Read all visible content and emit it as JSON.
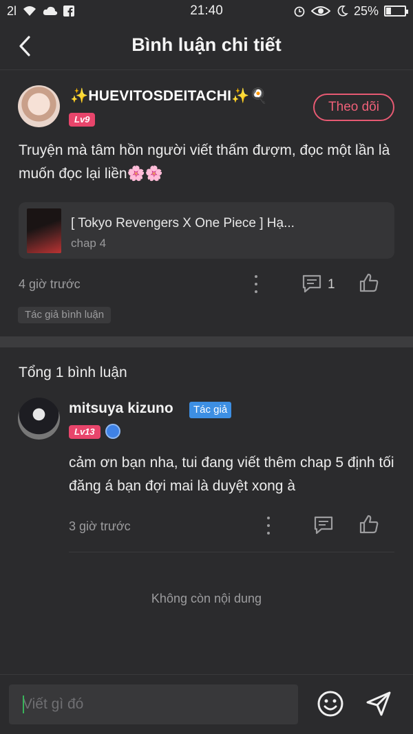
{
  "status_bar": {
    "signal": "2l",
    "time": "21:40",
    "battery": "25%",
    "battery_level": 0.25
  },
  "header": {
    "title": "Bình luận chi tiết"
  },
  "post": {
    "username": "✨HUEVITOSDEITACHI✨🍳",
    "level": "Lv9",
    "follow_label": "Theo dõi",
    "text": "Truyện mà tâm hồn người viết thấm đượm, đọc một lần là muốn đọc lại liền🌸🌸",
    "book": {
      "title": "[ Tokyo Revengers X One Piece ] Hạ...",
      "chapter": "chap 4"
    },
    "time": "4 giờ trước",
    "reply_count": "1",
    "author_tag": "Tác giả bình luận"
  },
  "comments_section": {
    "total_label": "Tổng 1 bình luận",
    "comments": [
      {
        "username": "mitsuya kizuno",
        "author_badge": "Tác giả",
        "level": "Lv13",
        "text": "cảm ơn bạn nha, tui đang viết thêm chap 5 định tối đăng á bạn đợi mai là duyệt xong à",
        "time": "3 giờ trước"
      }
    ],
    "end_label": "Không còn nội dung"
  },
  "composer": {
    "placeholder": "Viết gì đó"
  },
  "colors": {
    "accent": "#e8456b",
    "author_blue": "#3d8fe3",
    "background": "#2b2b2d"
  }
}
